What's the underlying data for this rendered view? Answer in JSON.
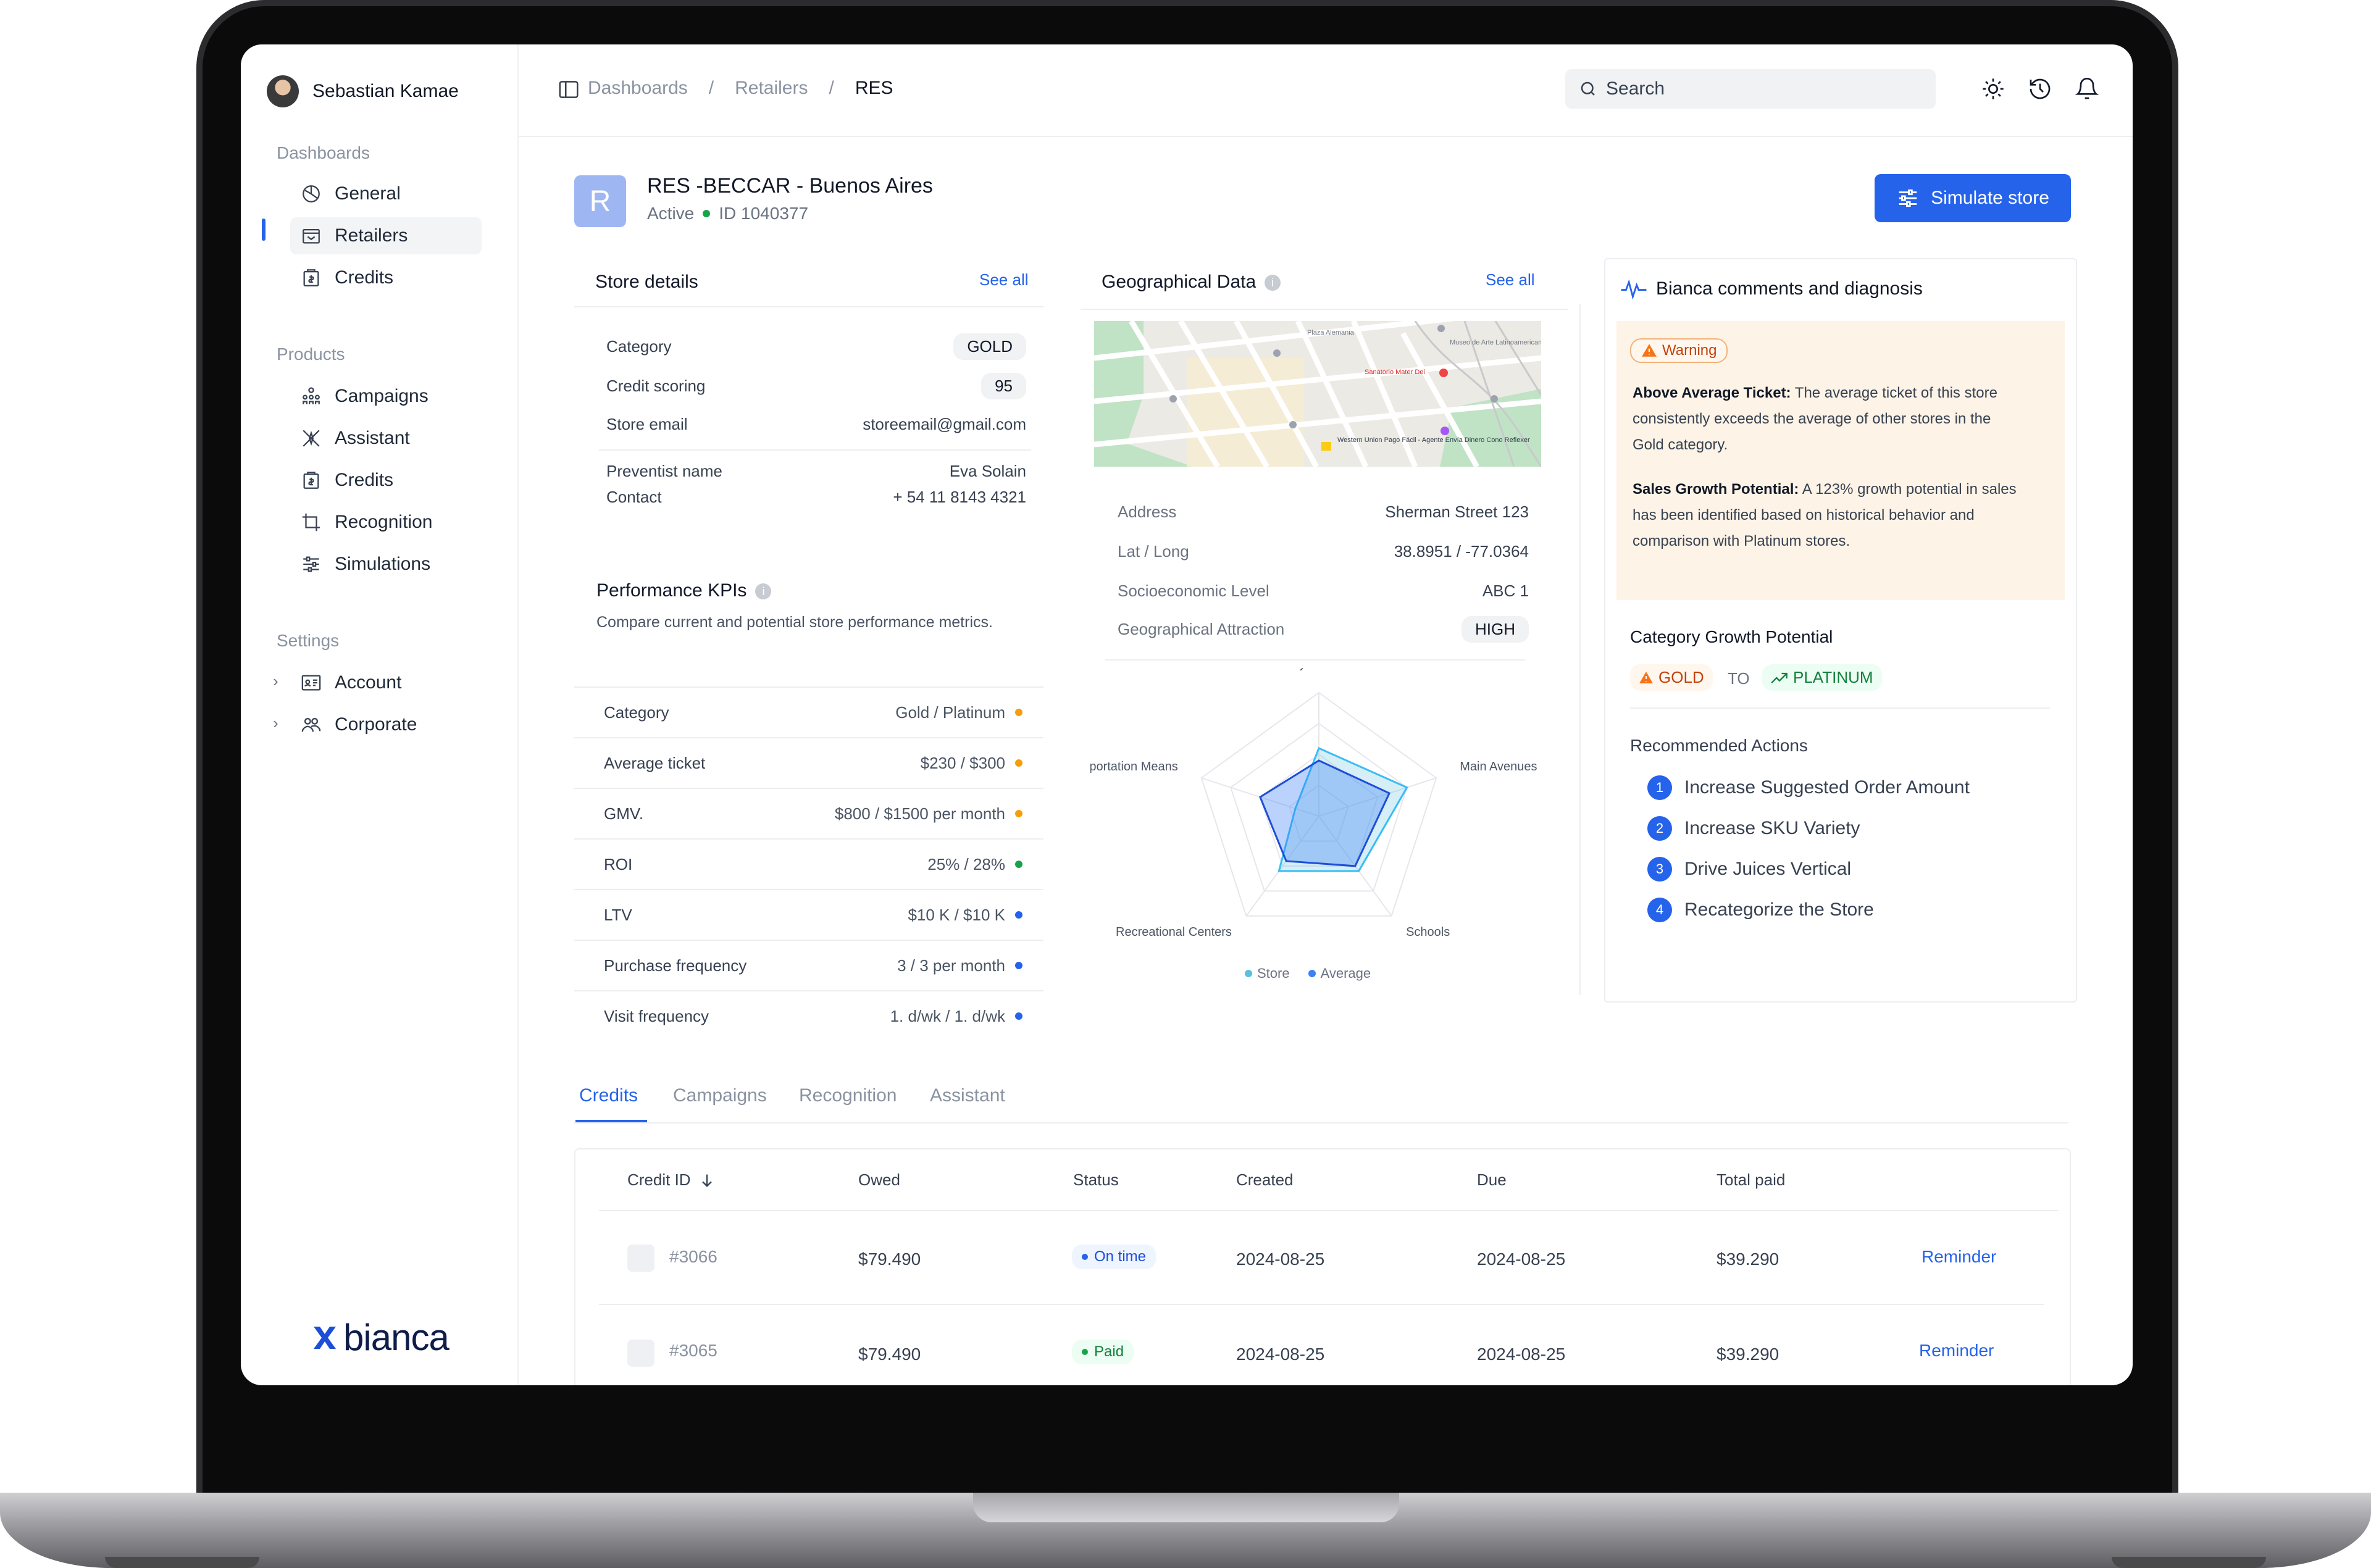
{
  "user": {
    "name": "Sebastian Kamae"
  },
  "sidebar": {
    "dashboards_title": "Dashboards",
    "dashboards": [
      {
        "label": "General",
        "icon": "pie-chart-icon"
      },
      {
        "label": "Retailers",
        "icon": "store-icon"
      },
      {
        "label": "Credits",
        "icon": "credits-icon"
      }
    ],
    "products_title": "Products",
    "products": [
      {
        "label": "Campaigns",
        "icon": "campaigns-icon"
      },
      {
        "label": "Assistant",
        "icon": "assistant-icon"
      },
      {
        "label": "Credits",
        "icon": "credits-icon"
      },
      {
        "label": "Recognition",
        "icon": "crop-icon"
      },
      {
        "label": "Simulations",
        "icon": "sliders-icon"
      }
    ],
    "settings_title": "Settings",
    "settings": [
      {
        "label": "Account",
        "icon": "id-card-icon"
      },
      {
        "label": "Corporate",
        "icon": "users-icon"
      }
    ],
    "brand": "bianca"
  },
  "topbar": {
    "breadcrumbs": [
      "Dashboards",
      "Retailers",
      "RES"
    ],
    "search_placeholder": "Search"
  },
  "header": {
    "badge_letter": "R",
    "title": "RES -BECCAR - Buenos Aires",
    "status": "Active",
    "id": "ID 1040377",
    "simulate_label": "Simulate store"
  },
  "store_details": {
    "title": "Store details",
    "see_all": "See all",
    "category_label": "Category",
    "category_value": "GOLD",
    "scoring_label": "Credit scoring",
    "scoring_value": "95",
    "email_label": "Store email",
    "email_value": "storeemail@gmail.com",
    "preventist_label": "Preventist name",
    "preventist_value": "Eva Solain",
    "contact_label": "Contact",
    "contact_value": "+ 54 11 8143 4321"
  },
  "kpis": {
    "title": "Performance KPIs",
    "subtitle": "Compare current and potential store performance metrics.",
    "rows": [
      {
        "label": "Category",
        "value": "Gold  /  Platinum",
        "color": "#f59e0b"
      },
      {
        "label": "Average ticket",
        "value": "$230  /  $300",
        "color": "#f59e0b"
      },
      {
        "label": "GMV.",
        "value": "$800  /  $1500 per month",
        "color": "#f59e0b"
      },
      {
        "label": "ROI",
        "value": "25%  /  28%",
        "color": "#16a34a"
      },
      {
        "label": "LTV",
        "value": "$10 K  /  $10 K",
        "color": "#2563eb"
      },
      {
        "label": "Purchase frequency",
        "value": "3  /  3 per month",
        "color": "#2563eb"
      },
      {
        "label": "Visit frequency",
        "value": "1. d/wk  /  1. d/wk",
        "color": "#2563eb"
      }
    ]
  },
  "geo": {
    "title": "Geographical Data",
    "see_all": "See all",
    "map_labels": [
      "Plaza Alemania",
      "Museo de Arte Latinoamericano de...",
      "Sanatorio Mater Dei",
      "Western Union Pago Fácil - Agente Envía Dinero Cono Reflexer"
    ],
    "address_label": "Address",
    "address_value": "Sherman Street 123",
    "latlong_label": "Lat / Long",
    "latlong_value": "38.8951 / -77.0364",
    "socio_label": "Socioeconomic Level",
    "socio_value": "ABC 1",
    "attraction_label": "Geographical Attraction",
    "attraction_value": "HIGH"
  },
  "chart_data": {
    "type": "radar",
    "axes": [
      "Nearby Businesses",
      "Main Avenues",
      "Schools",
      "Recreational Centers",
      "Transportation Means"
    ],
    "series": [
      {
        "name": "Store",
        "color": "#5bc0de",
        "values": [
          0.55,
          0.75,
          0.55,
          0.55,
          0.2
        ]
      },
      {
        "name": "Average",
        "color": "#3b82f6",
        "values": [
          0.45,
          0.6,
          0.5,
          0.45,
          0.5
        ]
      }
    ],
    "range": [
      0,
      1
    ]
  },
  "bianca": {
    "title": "Bianca comments and diagnosis",
    "warning_label": "Warning",
    "p1_bold": "Above Average Ticket:",
    "p1_l1": " The average ticket of this store",
    "p1_l2": "consistently exceeds the average of other stores in the",
    "p1_l3": "Gold category.",
    "p2_bold": "Sales Growth Potential:",
    "p2_l1": " A 123% growth potential in sales",
    "p2_l2": "has been identified based on historical behavior and",
    "p2_l3": "comparison with Platinum stores.",
    "growth_title": "Category Growth Potential",
    "from_tier": "GOLD",
    "to_word": "TO",
    "to_tier": "PLATINUM",
    "rec_title": "Recommended Actions",
    "actions": [
      "Increase Suggested Order Amount",
      "Increase SKU Variety",
      "Drive Juices Vertical",
      "Recategorize the Store"
    ]
  },
  "tabs": [
    "Credits",
    "Campaigns",
    "Recognition",
    "Assistant"
  ],
  "table": {
    "headers": [
      "Credit ID",
      "Owed",
      "Status",
      "Created",
      "Due",
      "Total paid"
    ],
    "rows": [
      {
        "id": "#3066",
        "owed": "$79.490",
        "status": "On time",
        "created": "2024-08-25",
        "due": "2024-08-25",
        "paid": "$39.290",
        "action": "Reminder"
      },
      {
        "id": "#3065",
        "owed": "$79.490",
        "status": "Paid",
        "created": "2024-08-25",
        "due": "2024-08-25",
        "paid": "$39.290",
        "action": "Reminder"
      }
    ]
  }
}
